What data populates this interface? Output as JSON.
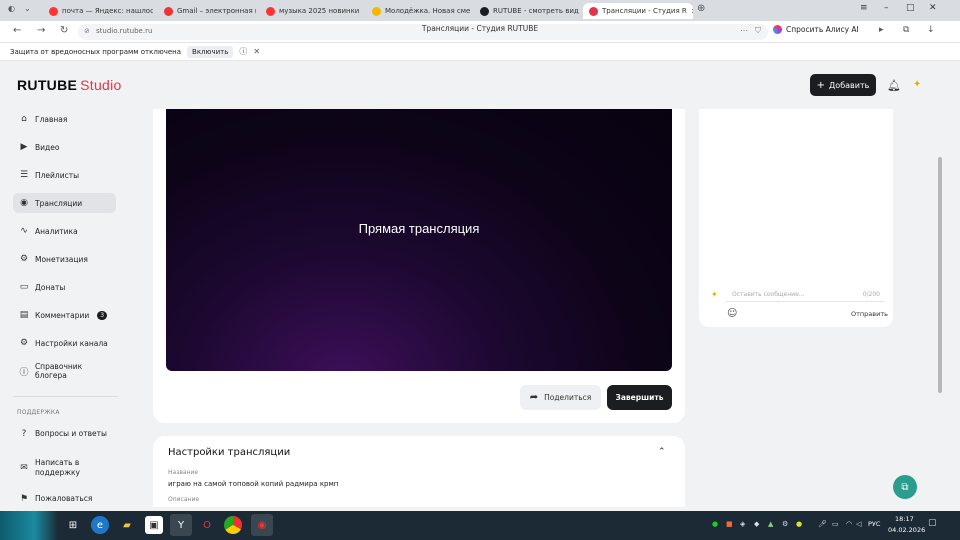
{
  "browser": {
    "tabs": [
      {
        "label": "почта — Яндекс: нашлось",
        "fav_color": "#f33",
        "active": false
      },
      {
        "label": "Gmail – электронная почт",
        "fav_color": "#e33",
        "active": false
      },
      {
        "label": "музыка 2025 новинки слу",
        "fav_color": "#f33",
        "active": false
      },
      {
        "label": "Молодёжка. Новая смен",
        "fav_color": "#f5b800",
        "active": false
      },
      {
        "label": "RUTUBE - смотреть виде",
        "fav_color": "#1c1d20",
        "active": false
      },
      {
        "label": "Трансляции - Студия R",
        "fav_color": "#e5334b",
        "active": true
      }
    ],
    "url": "studio.rutube.ru",
    "page_title": "Трансляции - Студия RUTUBE",
    "alice_label": "Спросить Алису AI"
  },
  "notice": {
    "text": "Защита от вредоносных программ отключена",
    "enable_label": "Включить"
  },
  "header": {
    "logo_main": "RUTUBE",
    "logo_sub": "Studio",
    "add_label": "Добавить"
  },
  "sidebar": {
    "items": [
      {
        "label": "Главная",
        "icon": "home-icon",
        "glyph": "⌂"
      },
      {
        "label": "Видео",
        "icon": "video-icon",
        "glyph": "▶"
      },
      {
        "label": "Плейлисты",
        "icon": "playlist-icon",
        "glyph": "☰"
      },
      {
        "label": "Трансляции",
        "icon": "broadcast-icon",
        "glyph": "◉"
      },
      {
        "label": "Аналитика",
        "icon": "analytics-icon",
        "glyph": "∿"
      },
      {
        "label": "Монетизация",
        "icon": "monetization-icon",
        "glyph": "⚙"
      },
      {
        "label": "Донаты",
        "icon": "donate-icon",
        "glyph": "▭"
      },
      {
        "label": "Комментарии",
        "icon": "comments-icon",
        "glyph": "▤",
        "badge": "3"
      },
      {
        "label": "Настройки канала",
        "icon": "settings-icon",
        "glyph": "⚙"
      },
      {
        "label": "Справочник блогера",
        "icon": "info-icon",
        "glyph": "ⓘ"
      }
    ],
    "support_heading": "ПОДДЕРЖКА",
    "support_items": [
      {
        "label": "Вопросы и ответы",
        "icon": "question-icon",
        "glyph": "?"
      },
      {
        "label": "Написать в поддержку",
        "icon": "mail-icon",
        "glyph": "✉"
      },
      {
        "label": "Пожаловаться",
        "icon": "flag-icon",
        "glyph": "⚑"
      }
    ]
  },
  "player": {
    "label": "Прямая трансляция",
    "share_label": "Поделиться",
    "end_label": "Завершить"
  },
  "settings": {
    "title": "Настройки трансляции",
    "name_label": "Название",
    "name_value": "играю на самой топовой копий радмира крмп",
    "desc_label": "Описание"
  },
  "chat": {
    "placeholder": "Оставить сообщение...",
    "counter": "0/200",
    "send_label": "Отправить"
  },
  "taskbar": {
    "lang": "РУС",
    "time": "18:17",
    "date": "04.02.2026"
  }
}
